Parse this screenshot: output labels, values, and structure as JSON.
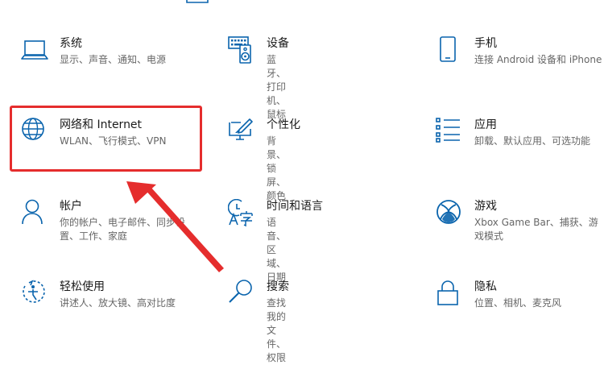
{
  "colors": {
    "accent": "#0a64ad",
    "annotation": "#e52d2d"
  },
  "settings": [
    {
      "title": "系统",
      "desc": "显示、声音、通知、电源",
      "icon": "laptop-icon"
    },
    {
      "title": "设备",
      "desc": "蓝牙、打印机、鼠标",
      "icon": "keyboard-speaker-icon"
    },
    {
      "title": "手机",
      "desc": "连接 Android 设备和 iPhone",
      "icon": "phone-icon"
    },
    {
      "title": "网络和 Internet",
      "desc": "WLAN、飞行模式、VPN",
      "icon": "globe-icon"
    },
    {
      "title": "个性化",
      "desc": "背景、锁屏、颜色",
      "icon": "paint-screen-icon"
    },
    {
      "title": "应用",
      "desc": "卸载、默认应用、可选功能",
      "icon": "app-list-icon"
    },
    {
      "title": "帐户",
      "desc": "你的帐户、电子邮件、同步设置、工作、家庭",
      "icon": "person-icon"
    },
    {
      "title": "时间和语言",
      "desc": "语音、区域、日期",
      "icon": "time-language-icon"
    },
    {
      "title": "游戏",
      "desc": "Xbox Game Bar、捕获、游戏模式",
      "icon": "xbox-icon"
    },
    {
      "title": "轻松使用",
      "desc": "讲述人、放大镜、高对比度",
      "icon": "ease-of-access-icon"
    },
    {
      "title": "搜索",
      "desc": "查找我的文件、权限",
      "icon": "search-icon"
    },
    {
      "title": "隐私",
      "desc": "位置、相机、麦克风",
      "icon": "lock-icon"
    }
  ]
}
